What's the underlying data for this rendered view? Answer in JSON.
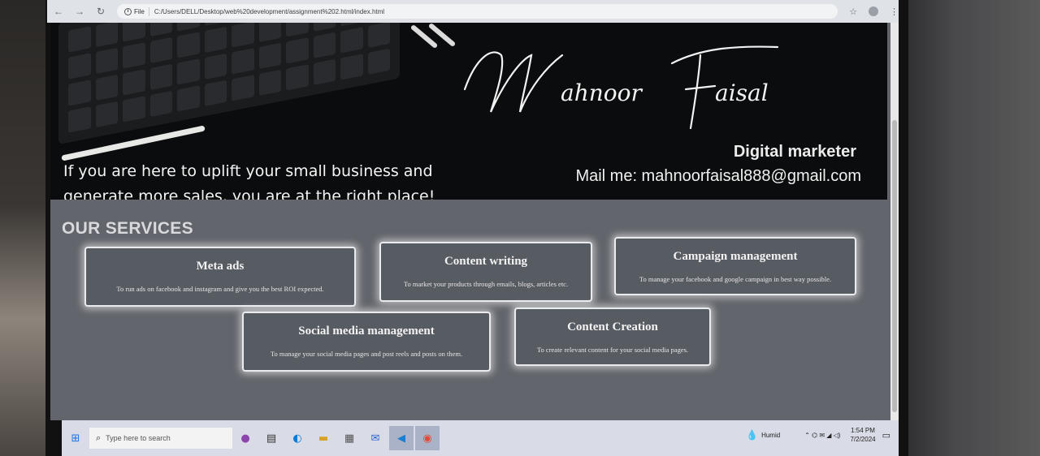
{
  "browser": {
    "back_icon": "←",
    "forward_icon": "→",
    "reload_icon": "↻",
    "file_label": "File",
    "url": "C:/Users/DELL/Desktop/web%20development/assignment%202.html/index.html",
    "star_icon": "☆",
    "menu_icon": "⋮"
  },
  "hero": {
    "signature": "Mahnoor Faisal",
    "tagline": "If you are here to uplift your small business and generate more sales, you are at the right place!",
    "role": "Digital marketer",
    "mail": "Mail me: mahnoorfaisal888@gmail.com"
  },
  "services": {
    "heading": "OUR SERVICES",
    "cards": [
      {
        "title": "Meta ads",
        "desc": "To run ads on facebook and instagram and give you the best ROI expected."
      },
      {
        "title": "Content writing",
        "desc": "To market your products through emails, blogs, articles etc."
      },
      {
        "title": "Campaign management",
        "desc": "To manage your facebook and google campaign in best way possible."
      },
      {
        "title": "Social media management",
        "desc": "To manage your social media pages and post reels and posts on them."
      },
      {
        "title": "Content Creation",
        "desc": "To create relevant content for your social media pages."
      }
    ]
  },
  "taskbar": {
    "start_icon": "⊞",
    "search_placeholder": "Type here to search",
    "search_icon": "⌕",
    "weather": "Humid",
    "time": "1:54 PM",
    "date": "7/2/2024",
    "tray_icons": "⌃ ⌬ ✉ ◢ ◁)"
  },
  "colors": {
    "page_bg": "#62656b",
    "hero_bg": "#0b0c0d",
    "card_bg": "#575b62",
    "card_glow": "#ffffff",
    "taskbar_bg": "#d9dce6"
  }
}
